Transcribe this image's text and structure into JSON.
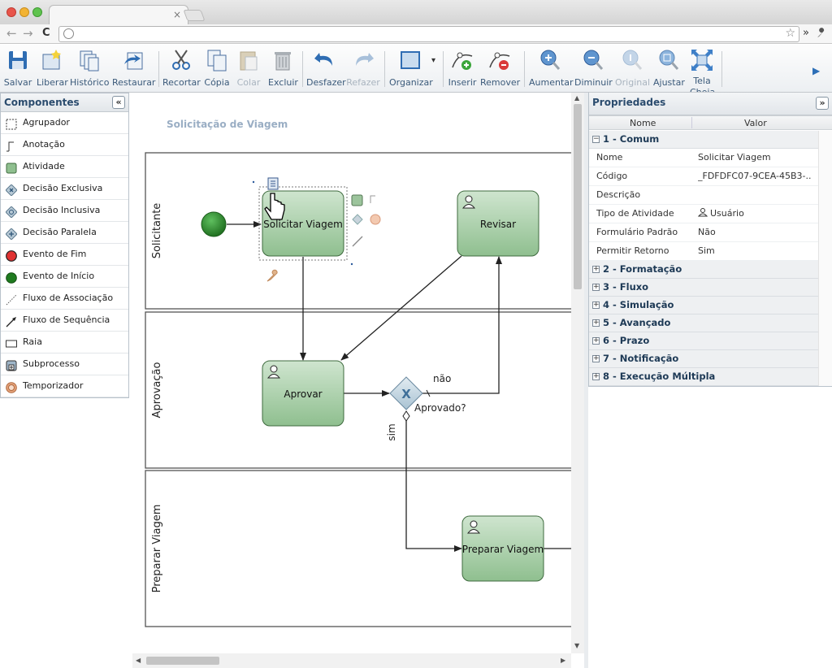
{
  "browser": {
    "controls": [
      "close",
      "minimize",
      "maximize"
    ],
    "tab_close": "×",
    "nav_back": "←",
    "nav_forward": "→",
    "nav_reload": "C",
    "star": "☆",
    "more": "»",
    "wrench": "🔧"
  },
  "toolbar": {
    "buttons": [
      {
        "label": "Salvar",
        "icon": "floppy-disk-icon",
        "enabled": true
      },
      {
        "label": "Liberar",
        "icon": "release-icon",
        "enabled": true
      },
      {
        "label": "Histórico",
        "icon": "history-icon",
        "enabled": true
      },
      {
        "label": "Restaurar",
        "icon": "restore-icon",
        "enabled": true
      },
      {
        "label": "Recortar",
        "icon": "scissors-icon",
        "enabled": true
      },
      {
        "label": "Cópia",
        "icon": "copy-icon",
        "enabled": true
      },
      {
        "label": "Colar",
        "icon": "paste-icon",
        "enabled": false
      },
      {
        "label": "Excluir",
        "icon": "trash-icon",
        "enabled": true
      },
      {
        "label": "Desfazer",
        "icon": "undo-icon",
        "enabled": true
      },
      {
        "label": "Refazer",
        "icon": "redo-icon",
        "enabled": false
      },
      {
        "label": "Organizar",
        "icon": "arrange-icon",
        "enabled": true
      },
      {
        "label": "Inserir",
        "icon": "insert-point-icon",
        "enabled": true
      },
      {
        "label": "Remover",
        "icon": "remove-point-icon",
        "enabled": true
      },
      {
        "label": "Aumentar",
        "icon": "zoom-in-icon",
        "enabled": true
      },
      {
        "label": "Diminuir",
        "icon": "zoom-out-icon",
        "enabled": true
      },
      {
        "label": "Original",
        "icon": "zoom-original-icon",
        "enabled": false
      },
      {
        "label": "Ajustar",
        "icon": "zoom-fit-icon",
        "enabled": true
      },
      {
        "label": "Tela Cheia",
        "icon": "fullscreen-icon",
        "enabled": true
      }
    ],
    "more_arrow": "▶"
  },
  "components_panel": {
    "title": "Componentes",
    "collapse": "«",
    "items": [
      {
        "label": "Agrupador",
        "icon": "group-icon"
      },
      {
        "label": "Anotação",
        "icon": "annotation-icon"
      },
      {
        "label": "Atividade",
        "icon": "activity-icon"
      },
      {
        "label": "Decisão Exclusiva",
        "icon": "exclusive-gateway-icon"
      },
      {
        "label": "Decisão Inclusiva",
        "icon": "inclusive-gateway-icon"
      },
      {
        "label": "Decisão Paralela",
        "icon": "parallel-gateway-icon"
      },
      {
        "label": "Evento de Fim",
        "icon": "end-event-icon"
      },
      {
        "label": "Evento de Início",
        "icon": "start-event-icon"
      },
      {
        "label": "Fluxo de Associação",
        "icon": "association-flow-icon"
      },
      {
        "label": "Fluxo de Sequência",
        "icon": "sequence-flow-icon"
      },
      {
        "label": "Raia",
        "icon": "lane-icon"
      },
      {
        "label": "Subprocesso",
        "icon": "subprocess-icon"
      },
      {
        "label": "Temporizador",
        "icon": "timer-icon"
      }
    ]
  },
  "diagram": {
    "title": "Solicitação de Viagem",
    "lanes": [
      "Solicitante",
      "Aprovação",
      "Preparar Viagem"
    ],
    "tasks": {
      "solicitar": "Solicitar Viagem",
      "revisar": "Revisar",
      "aprovar": "Aprovar",
      "preparar": "Preparar Viagem"
    },
    "gateway": {
      "label": "Aprovado?",
      "marker": "X"
    },
    "flow_labels": {
      "no": "não",
      "yes": "sim"
    }
  },
  "properties_panel": {
    "title": "Propriedades",
    "expand": "»",
    "columns": [
      "Nome",
      "Valor"
    ],
    "groups": [
      {
        "label": "1 - Comum",
        "expanded": true
      },
      {
        "label": "2 - Formatação",
        "expanded": false
      },
      {
        "label": "3 - Fluxo",
        "expanded": false
      },
      {
        "label": "4 - Simulação",
        "expanded": false
      },
      {
        "label": "5 - Avançado",
        "expanded": false
      },
      {
        "label": "6 - Prazo",
        "expanded": false
      },
      {
        "label": "7 - Notificação",
        "expanded": false
      },
      {
        "label": "8 - Execução Múltipla",
        "expanded": false
      }
    ],
    "rows": [
      {
        "name": "Nome",
        "value": "Solicitar Viagem"
      },
      {
        "name": "Código",
        "value": "_FDFDFC07-9CEA-45B3-..."
      },
      {
        "name": "Descrição",
        "value": ""
      },
      {
        "name": "Tipo de Atividade",
        "value": "Usuário"
      },
      {
        "name": "Formulário Padrão",
        "value": "Não"
      },
      {
        "name": "Permitir Retorno",
        "value": "Sim"
      }
    ],
    "collapsed_sign": "+",
    "expanded_sign": "−"
  },
  "colors": {
    "accent": "#3b5a7a",
    "task_fill_top": "#c7dfc7",
    "task_fill_bottom": "#8dbc8d",
    "start_event": "#2e8b2e",
    "diagram_title": "#9aaec4"
  }
}
